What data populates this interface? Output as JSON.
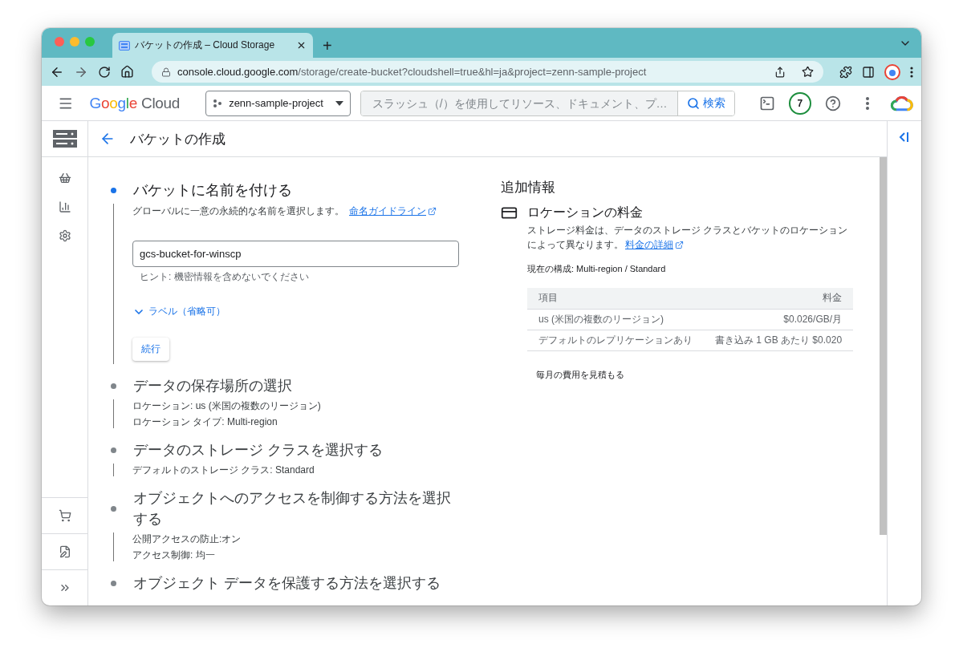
{
  "browser": {
    "tab": {
      "title": "バケットの作成 – Cloud Storage",
      "selected": true
    },
    "new_tab": "+",
    "address": {
      "host": "console.cloud.google.com",
      "path": "/storage/create-bucket?cloudshell=true&hl=ja&project=zenn-sample-project"
    }
  },
  "header": {
    "logo": {
      "brand": "Google",
      "product": "Cloud"
    },
    "project": "zenn-sample-project",
    "search": {
      "placeholder": "スラッシュ（/）を使用してリソース、ドキュメント、プ…"
    },
    "search_button": "検索",
    "notifications": "7"
  },
  "page": {
    "title": "バケットの作成"
  },
  "steps": [
    {
      "kind": "form",
      "title": "バケットに名前を付ける",
      "active": true,
      "description": "グローバルに一意の永続的な名前を選択します。",
      "link": "命名ガイドライン",
      "input": {
        "value": "gcs-bucket-for-winscp"
      },
      "hint": "ヒント: 機密情報を含めないでください",
      "labels_toggle": "ラベル（省略可）",
      "continue_button": "続行"
    },
    {
      "kind": "summary",
      "title": "データの保存場所の選択",
      "active": false,
      "details": [
        "ロケーション: us (米国の複数のリージョン)",
        "ロケーション タイプ: Multi-region"
      ]
    },
    {
      "kind": "summary",
      "title": "データのストレージ クラスを選択する",
      "active": false,
      "details": [
        "デフォルトのストレージ クラス: Standard"
      ]
    },
    {
      "kind": "summary",
      "title": "オブジェクトへのアクセスを制御する方法を選択する",
      "active": false,
      "details": [
        "公開アクセスの防止:オン",
        "アクセス制御: 均一"
      ]
    },
    {
      "kind": "summary",
      "title": "オブジェクト データを保護する方法を選択する",
      "active": false
    }
  ],
  "side_panel": {
    "title": "追加情報",
    "section": {
      "title": "ロケーションの料金",
      "description": "ストレージ料金は、データのストレージ クラスとバケットのロケーションによって異なります。",
      "link": "料金の詳細"
    },
    "config": "現在の構成: Multi-region / Standard",
    "table": {
      "columns": [
        "項目",
        "料金"
      ],
      "rows": [
        [
          "us (米国の複数のリージョン)",
          "$0.026/GB/月"
        ],
        [
          "デフォルトのレプリケーションあり",
          "書き込み 1 GB あたり $0.020"
        ]
      ]
    },
    "estimate": "毎月の費用を見積もる"
  }
}
